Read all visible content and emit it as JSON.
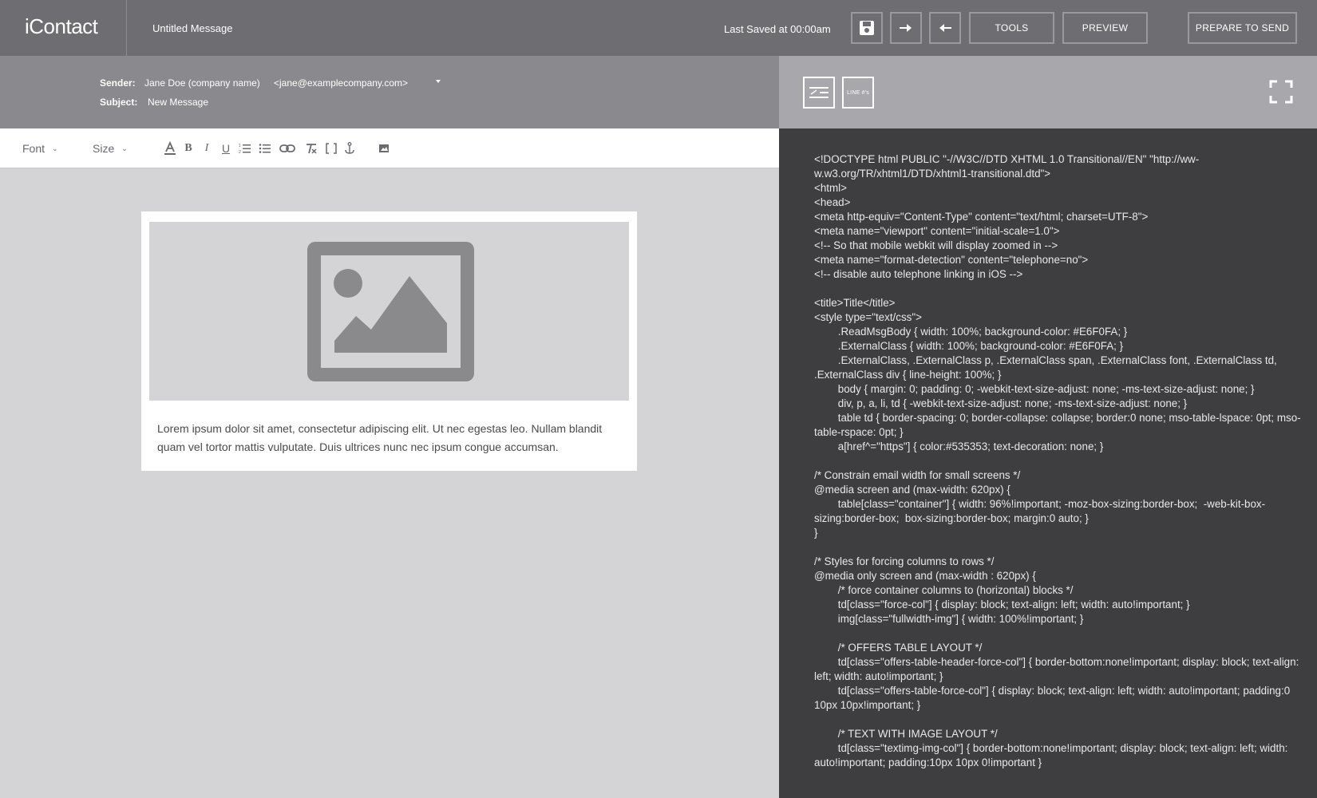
{
  "topbar": {
    "logo": "iContact",
    "message_title": "Untitled Message",
    "last_saved": "Last Saved at 00:00am",
    "icons": [
      "save-icon",
      "redo-arrow-icon",
      "undo-arrow-icon"
    ],
    "tools_label": "TOOLS",
    "preview_label": "PREVIEW",
    "prepare_label": "PREPARE TO SEND"
  },
  "message": {
    "sender_label": "Sender:",
    "sender_name": "Jane Doe (company name)",
    "sender_email": "<jane@examplecompany.com>",
    "subject_label": "Subject:",
    "subject_value": "New Message"
  },
  "toolbar": {
    "font_label": "Font",
    "size_label": "Size",
    "icons": [
      "font-color-icon",
      "bold-icon",
      "italic-icon",
      "underline-icon",
      "ordered-list-icon",
      "unordered-list-icon",
      "link-icon",
      "clear-format-icon",
      "brackets-icon",
      "anchor-icon",
      "image-icon"
    ]
  },
  "email": {
    "body_text": "Lorem ipsum dolor sit amet, consectetur adipiscing elit. Ut nec egestas leo. Nullam blandit quam vel tortor mattis vulputate. Duis ultrices nunc nec ipsum congue accumsan."
  },
  "code_panel": {
    "line_numbers_label": "LINE #'s",
    "code": "<!DOCTYPE html PUBLIC \"-//W3C//DTD XHTML 1.0 Transitional//EN\" \"http://ww-w.w3.org/TR/xhtml1/DTD/xhtml1-transitional.dtd\">\n<html>\n<head>\n<meta http-equiv=\"Content-Type\" content=\"text/html; charset=UTF-8\">\n<meta name=\"viewport\" content=\"initial-scale=1.0\">\n<!-- So that mobile webkit will display zoomed in -->\n<meta name=\"format-detection\" content=\"telephone=no\">\n<!-- disable auto telephone linking in iOS -->\n\n<title>Title</title>\n<style type=\"text/css\">\n        .ReadMsgBody { width: 100%; background-color: #E6F0FA; }\n        .ExternalClass { width: 100%; background-color: #E6F0FA; }\n        .ExternalClass, .ExternalClass p, .ExternalClass span, .ExternalClass font, .ExternalClass td, .ExternalClass div { line-height: 100%; }\n        body { margin: 0; padding: 0; -webkit-text-size-adjust: none; -ms-text-size-adjust: none; }\n        div, p, a, li, td { -webkit-text-size-adjust: none; -ms-text-size-adjust: none; }\n        table td { border-spacing: 0; border-collapse: collapse; border:0 none; mso-table-lspace: 0pt; mso-table-rspace: 0pt; }\n        a[href^=\"https\"] { color:#535353; text-decoration: none; }\n\n/* Constrain email width for small screens */\n@media screen and (max-width: 620px) {\n        table[class=\"container\"] { width: 96%!important; -moz-box-sizing:border-box;  -web-kit-box-sizing:border-box;  box-sizing:border-box; margin:0 auto; }\n}\n\n/* Styles for forcing columns to rows */\n@media only screen and (max-width : 620px) {\n        /* force container columns to (horizontal) blocks */\n        td[class=\"force-col\"] { display: block; text-align: left; width: auto!important; }\n        img[class=\"fullwidth-img\"] { width: 100%!important; }\n\n        /* OFFERS TABLE LAYOUT */\n        td[class=\"offers-table-header-force-col\"] { border-bottom:none!important; display: block; text-align: left; width: auto!important; }\n        td[class=\"offers-table-force-col\"] { display: block; text-align: left; width: auto!important; padding:0 10px 10px!important; }\n\n        /* TEXT WITH IMAGE LAYOUT */\n        td[class=\"textimg-img-col\"] { border-bottom:none!important; display: block; text-align: left; width: auto!important; padding:10px 10px 0!important }"
  }
}
